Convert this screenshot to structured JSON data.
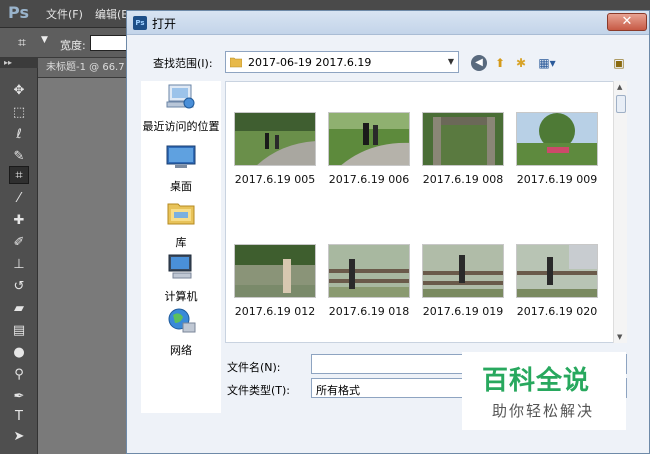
{
  "app": {
    "logo": "Ps",
    "menus": [
      "文件(F)",
      "编辑(E)"
    ],
    "options": {
      "width_label": "宽度:"
    },
    "doc_tab": "未标题-1 @ 66.7"
  },
  "dialog": {
    "title": "打开",
    "close_glyph": "✕",
    "look_in_label": "查找范围(I):",
    "look_in_value": "2017-06-19 2017.6.19",
    "places": [
      {
        "label": "最近访问的位置",
        "icon": "recent-places-icon"
      },
      {
        "label": "桌面",
        "icon": "desktop-icon"
      },
      {
        "label": "库",
        "icon": "libraries-icon"
      },
      {
        "label": "计算机",
        "icon": "computer-icon"
      },
      {
        "label": "网络",
        "icon": "network-icon"
      }
    ],
    "files": [
      {
        "name": "2017.6.19 005"
      },
      {
        "name": "2017.6.19 006"
      },
      {
        "name": "2017.6.19 008"
      },
      {
        "name": "2017.6.19 009"
      },
      {
        "name": "2017.6.19 012"
      },
      {
        "name": "2017.6.19 018"
      },
      {
        "name": "2017.6.19 019"
      },
      {
        "name": "2017.6.19 020"
      }
    ],
    "filename_label": "文件名(N):",
    "filename_value": "",
    "filetype_label": "文件类型(T):",
    "filetype_value": "所有格式"
  },
  "watermark": {
    "main": "百科全说",
    "sub": "助你轻松解决"
  },
  "colors": {
    "dialog_bg": "#eef2f8",
    "watermark_green": "#28a85e"
  }
}
